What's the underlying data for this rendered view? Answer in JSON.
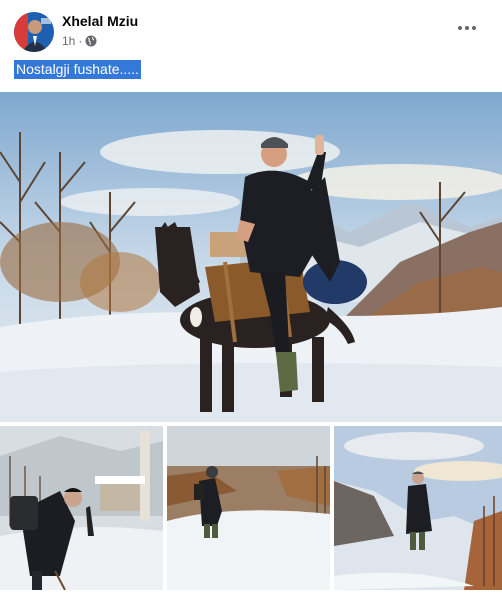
{
  "post": {
    "author_name": "Xhelal Mziu",
    "time": "1h",
    "separator": "·",
    "privacy_icon": "globe-icon",
    "more_icon": "more-options-icon",
    "caption": "Nostalgji fushate.....",
    "photos": [
      {
        "kind": "main",
        "subject": "man-on-horse-in-snow"
      },
      {
        "kind": "thumb",
        "subject": "man-with-backpack-in-village"
      },
      {
        "kind": "thumb",
        "subject": "person-on-snowy-slope"
      },
      {
        "kind": "thumb",
        "subject": "person-on-mountain-ridge"
      }
    ]
  },
  "colors": {
    "caption_highlight": "#3478d9",
    "author_text": "#050505",
    "meta_text": "#65676b"
  }
}
